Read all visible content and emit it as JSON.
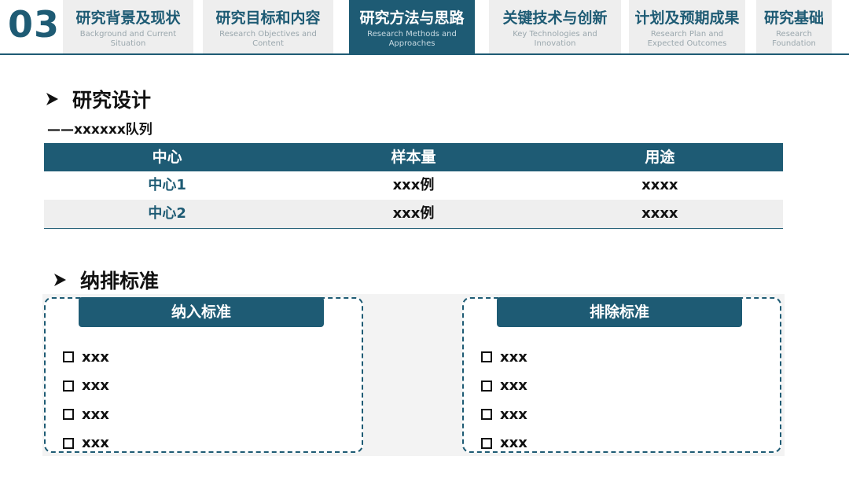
{
  "header": {
    "section_number": "03",
    "tabs": [
      {
        "cn": "研究背景及现状",
        "en": "Background and Current Situation",
        "active": false
      },
      {
        "cn": "研究目标和内容",
        "en": "Research Objectives and Content",
        "active": false
      },
      {
        "cn": "研究方法与思路",
        "en": "Research Methods and Approaches",
        "active": true
      },
      {
        "cn": "关键技术与创新",
        "en": "Key Technologies and Innovation",
        "active": false
      },
      {
        "cn": "计划及预期成果",
        "en": "Research Plan and Expected Outcomes",
        "active": false
      },
      {
        "cn": "研究基础",
        "en": "Research Foundation",
        "active": false
      }
    ],
    "accent_color": "#1e5b74"
  },
  "design": {
    "title": "研究设计",
    "subtitle": "——xxxxxx队列",
    "table": {
      "headers": [
        "中心",
        "样本量",
        "用途"
      ],
      "rows": [
        [
          "中心1",
          "xxx例",
          "xxxx"
        ],
        [
          "中心2",
          "xxx例",
          "xxxx"
        ]
      ]
    }
  },
  "criteria": {
    "title": "纳排标准",
    "inclusion": {
      "title": "纳入标准",
      "items": [
        "xxx",
        "xxx",
        "xxx",
        "xxx"
      ]
    },
    "exclusion": {
      "title": "排除标准",
      "items": [
        "xxx",
        "xxx",
        "xxx",
        "xxx"
      ]
    }
  },
  "icons": {
    "heading_marker": "arrow-right-icon",
    "list_marker": "checkbox-icon"
  }
}
